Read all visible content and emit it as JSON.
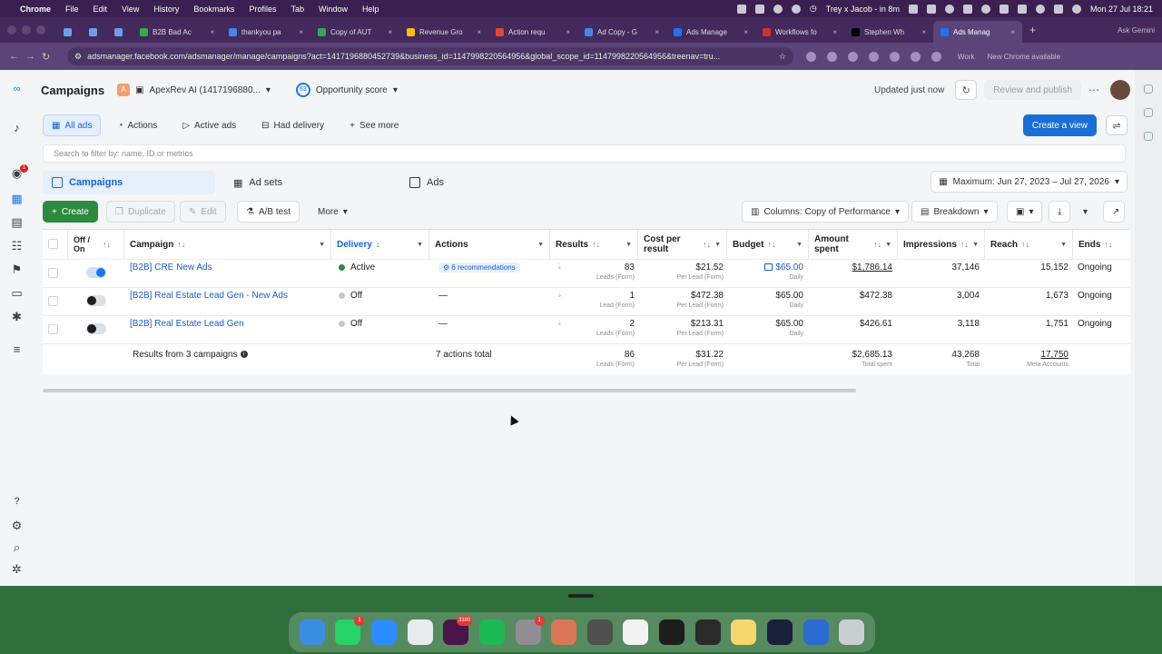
{
  "menubar": {
    "app": "Chrome",
    "items": [
      "File",
      "Edit",
      "View",
      "History",
      "Bookmarks",
      "Profiles",
      "Tab",
      "Window",
      "Help"
    ],
    "event": "Trey x Jacob - in 8m",
    "datetime": "Mon 27 Jul 18:21"
  },
  "tabs": [
    {
      "label": "B2B Bad Ac",
      "color": "#34a853"
    },
    {
      "label": "thankyou pa",
      "color": "#4285f4"
    },
    {
      "label": "Copy of AUT",
      "color": "#34a853"
    },
    {
      "label": "Revenue Gro",
      "color": "#fbbc05"
    },
    {
      "label": "Action requ",
      "color": "#ea4335"
    },
    {
      "label": "Ad Copy - G",
      "color": "#4285f4"
    },
    {
      "label": "Ads Manage",
      "color": "#1877f2"
    },
    {
      "label": "Workflows fo",
      "color": "#d32f2f"
    },
    {
      "label": "Stephen Wh",
      "color": "#000000"
    },
    {
      "label": "Ads Manag",
      "color": "#1877f2",
      "active": true
    }
  ],
  "browser": {
    "url": "adsmanager.facebook.com/adsmanager/manage/campaigns?act=1417196880452739&business_id=1147998220564956&global_scope_id=1147998220564956&treenav=tru...",
    "gemini": "Ask Gemini",
    "profile_label": "Work",
    "notice": "New Chrome available"
  },
  "header": {
    "title": "Campaigns",
    "account_initial": "A",
    "account": "ApexRev AI (1417196880...",
    "opportunity_score_value": "63",
    "opportunity_score_label": "Opportunity score",
    "updated": "Updated just now",
    "review": "Review and publish"
  },
  "filters": {
    "items": [
      "All ads",
      "Actions",
      "Active ads",
      "Had delivery"
    ],
    "see_more": "See more",
    "create_view": "Create a view"
  },
  "search": {
    "placeholder": "Search to filter by: name, ID or metrics"
  },
  "levels": {
    "campaigns": "Campaigns",
    "ad_sets": "Ad sets",
    "ads": "Ads",
    "date_range": "Maximum: Jun 27, 2023 – Jul 27, 2026"
  },
  "toolbar": {
    "create": "Create",
    "duplicate": "Duplicate",
    "edit": "Edit",
    "ab_test": "A/B test",
    "more": "More",
    "columns": "Columns: Copy of Performance",
    "breakdown": "Breakdown"
  },
  "columns": {
    "off_on": "Off / On",
    "campaign": "Campaign",
    "delivery": "Delivery",
    "actions": "Actions",
    "results": "Results",
    "cost_per_result": "Cost per result",
    "budget": "Budget",
    "amount_spent": "Amount spent",
    "impressions": "Impressions",
    "reach": "Reach",
    "ends": "Ends"
  },
  "rows": [
    {
      "name": "[B2B] CRE New Ads",
      "on": true,
      "delivery": "Active",
      "delivery_color": "#2b8a3e",
      "actions": "6 recommendations",
      "results": "83",
      "results_sub": "Leads (Form)",
      "cpr": "$21.52",
      "cpr_sub": "Per Lead (Form)",
      "budget": "$65.00",
      "budget_sub": "Daily",
      "spent": "$1,786.14",
      "impressions": "37,146",
      "reach": "15,152",
      "ends": "Ongoing"
    },
    {
      "name": "[B2B] Real Estate Lead Gen - New Ads",
      "on": false,
      "delivery": "Off",
      "delivery_color": "#c4c7cc",
      "actions": "—",
      "results": "1",
      "results_sub": "Lead (Form)",
      "cpr": "$472.38",
      "cpr_sub": "Per Lead (Form)",
      "budget": "$65.00",
      "budget_sub": "Daily",
      "spent": "$472.38",
      "impressions": "3,004",
      "reach": "1,673",
      "ends": "Ongoing"
    },
    {
      "name": "[B2B] Real Estate Lead Gen",
      "on": false,
      "delivery": "Off",
      "delivery_color": "#c4c7cc",
      "actions": "—",
      "results": "2",
      "results_sub": "Leads (Form)",
      "cpr": "$213.31",
      "cpr_sub": "Per Lead (Form)",
      "budget": "$65.00",
      "budget_sub": "Daily",
      "spent": "$426.61",
      "impressions": "3,118",
      "reach": "1,751",
      "ends": "Ongoing"
    }
  ],
  "totals": {
    "label": "Results from 3 campaigns",
    "actions": "7 actions total",
    "results": "86",
    "results_sub": "Leads (Form)",
    "cpr": "$31.22",
    "cpr_sub": "Per Lead (Form)",
    "spent": "$2,685.13",
    "spent_sub": "Total spent",
    "impressions": "43,268",
    "impressions_sub": "Total",
    "reach": "17,750",
    "reach_sub": "Meta Accounts"
  },
  "dock": [
    {
      "name": "finder",
      "color": "#3b8de0"
    },
    {
      "name": "whatsapp",
      "color": "#25d366",
      "badge": "1"
    },
    {
      "name": "zoom",
      "color": "#2d8cff"
    },
    {
      "name": "chrome",
      "color": "#e8eaed"
    },
    {
      "name": "slack",
      "color": "#4a154b",
      "badge": "3380"
    },
    {
      "name": "spotify",
      "color": "#1db954"
    },
    {
      "name": "system-settings",
      "color": "#8e8e93",
      "badge": "1"
    },
    {
      "name": "claude",
      "color": "#d97757"
    },
    {
      "name": "calculator",
      "color": "#505050"
    },
    {
      "name": "chatgpt",
      "color": "#f2f2f2"
    },
    {
      "name": "spiral",
      "color": "#1c1c1c"
    },
    {
      "name": "bars-app",
      "color": "#2a2a2a"
    },
    {
      "name": "notes",
      "color": "#f5d76e"
    },
    {
      "name": "cursor-app",
      "color": "#1b1f3a"
    },
    {
      "name": "gear-app",
      "color": "#2a6bd1"
    },
    {
      "name": "trash",
      "color": "#c9ced3"
    }
  ]
}
